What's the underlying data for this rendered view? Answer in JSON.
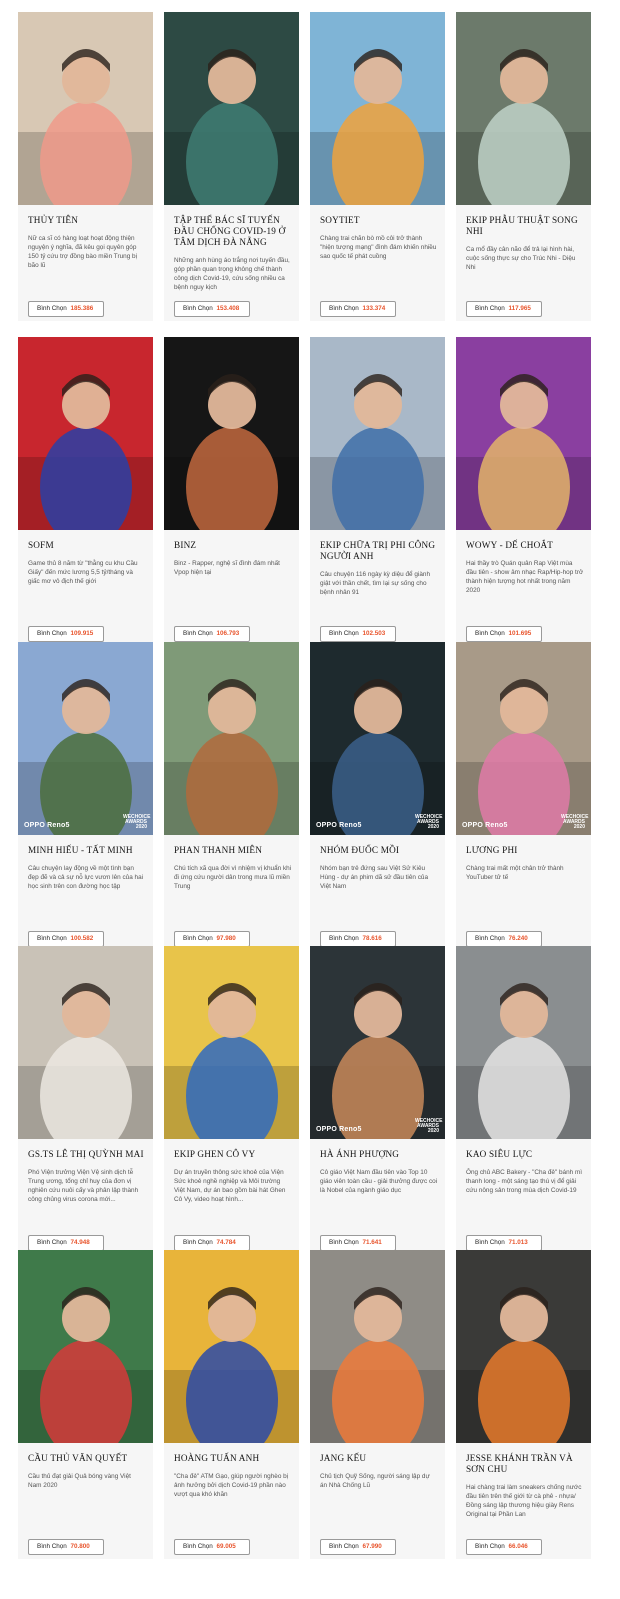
{
  "vote_label": "Bình Chọn",
  "cards": [
    {
      "name": "THỦY TIÊN",
      "desc": "Nữ ca sĩ có hàng loạt hoạt động thiện nguyện ý nghĩa, đã kêu gọi quyên góp 150 tỷ cứu trợ đồng bào miền Trung bị bão lũ",
      "votes": "185.386",
      "bg": "#d8c8b4",
      "fg": "#f09a8a"
    },
    {
      "name": "TẬP THỂ BÁC SĨ TUYẾN ĐẦU CHỐNG COVID-19 Ở TÂM DỊCH ĐÀ NẴNG",
      "desc": "Những anh hùng áo trắng nơi tuyến đầu, góp phần quan trọng không chế thành công dịch Covid-19, cứu sống nhiều ca bệnh nguy kịch",
      "votes": "153.408",
      "bg": "#2d4a44",
      "fg": "#3f7d73"
    },
    {
      "name": "SOYTIET",
      "desc": "Chàng trai chăn bò mồ côi trở thành \"hiện tượng mạng\" đình đám khiến nhiều sao quốc tế phát cuồng",
      "votes": "133.374",
      "bg": "#7fb4d6",
      "fg": "#f0a23c"
    },
    {
      "name": "EKIP PHẪU THUẬT SONG NHI",
      "desc": "Ca mổ đầy cân não để trả lại hình hài, cuộc sống thực sự cho Trúc Nhi - Diệu Nhi",
      "votes": "117.965",
      "bg": "#6c7a6b",
      "fg": "#bfd2c8"
    },
    {
      "name": "SOFM",
      "desc": "Game thủ 8 năm từ \"thằng cu khu Cầu Giấy\" đến mức lương 5,5 tỷ/tháng và giấc mơ vô địch thế giới",
      "votes": "109.915",
      "bg": "#c8262e",
      "fg": "#2a3fa6"
    },
    {
      "name": "BINZ",
      "desc": "Binz - Rapper, nghệ sĩ đình đám nhất Vpop hiện tại",
      "votes": "106.793",
      "bg": "#161616",
      "fg": "#c2683e"
    },
    {
      "name": "EKIP CHỮA TRỊ PHI CÔNG NGƯỜI ANH",
      "desc": "Câu chuyện 116 ngày kỳ diệu để giành giật với thần chết, tìm lại sự sống cho bệnh nhân 91",
      "votes": "102.503",
      "bg": "#a9b8c8",
      "fg": "#3f6fa8"
    },
    {
      "name": "WOWY - DẾ CHOẮT",
      "desc": "Hai thầy trò Quán quân Rap Việt mùa đầu tiên - show âm nhạc Rap/Hip-hop trở thành hiện tượng hot nhất trong năm 2020",
      "votes": "101.695",
      "bg": "#8a3fa0",
      "fg": "#e3b46a"
    },
    {
      "name": "MINH HIẾU - TẤT MINH",
      "desc": "Câu chuyện lay động về một tình bạn đẹp đẽ và cả sự nỗ lực vươn lên của hai học sinh trên con đường học tập",
      "votes": "100.582",
      "bg": "#8aa8d2",
      "fg": "#4b6e3c",
      "brand": "OPPO Reno5"
    },
    {
      "name": "PHAN THANH MIÊN",
      "desc": "Chú tích xã qua đời vì nhiệm vị khuẩn khi đi ứng cứu người dân trong mưa lũ miền Trung",
      "votes": "97.980",
      "bg": "#7f9a78",
      "fg": "#b26a3c"
    },
    {
      "name": "NHÓM ĐUỐC MỒI",
      "desc": "Nhóm bạn trẻ đứng sau Việt Sử Kiêu Hùng - dự án phim dã sử đầu tiên của Việt Nam",
      "votes": "78.616",
      "bg": "#1e2a2e",
      "fg": "#3b5f8a",
      "brand": "OPPO Reno5"
    },
    {
      "name": "LƯƠNG PHI",
      "desc": "Chàng trai mất một chân trở thành YouTuber tử tế",
      "votes": "76.240",
      "bg": "#a89a88",
      "fg": "#e07aa8",
      "brand": "OPPO Reno5"
    },
    {
      "name": "GS.TS LÊ THỊ QUỲNH MAI",
      "desc": "Phó Viện trưởng Viện Vệ sinh dịch tễ Trung ương, tổng chỉ huy của đơn vị nghiên cứu nuôi cấy và phân lập thành công chủng virus corona mới...",
      "votes": "74.948",
      "bg": "#c9c2b7",
      "fg": "#ece8e2"
    },
    {
      "name": "EKIP GHEN CÔ VY",
      "desc": "Dự án truyền thông sức khoẻ của Viện Sức khoẻ nghề nghiệp và Môi trường Việt Nam, dự án bao gồm bài hát Ghen Cô Vy, video hoạt hình...",
      "votes": "74.784",
      "bg": "#e8c44a",
      "fg": "#2f6ac0"
    },
    {
      "name": "HÀ ÁNH PHƯỢNG",
      "desc": "Cô giáo Việt Nam đầu tiên vào Top 10 giáo viên toàn cầu - giải thưởng được coi là Nobel của ngành giáo dục",
      "votes": "71.641",
      "bg": "#2c3438",
      "fg": "#c98a5a",
      "brand": "OPPO Reno5"
    },
    {
      "name": "KAO SIÊU LỰC",
      "desc": "Ông chủ ABC Bakery - \"Cha đẻ\" bánh mì thanh long - một sáng tạo thú vị để giải cứu nông sản trong mùa dịch Covid-19",
      "votes": "71.013",
      "bg": "#8a8e90",
      "fg": "#e4e4e4"
    },
    {
      "name": "CẦU THỦ VĂN QUYẾT",
      "desc": "Cầu thủ đạt giải Quả bóng vàng Việt Nam 2020",
      "votes": "70.800",
      "bg": "#3f7a4a",
      "fg": "#d63a3a"
    },
    {
      "name": "HOÀNG TUẤN ANH",
      "desc": "\"Cha đẻ\" ATM Gạo, giúp người nghèo bị ảnh hưởng bởi dịch Covid-19 phần nào vượt qua khó khăn",
      "votes": "69.005",
      "bg": "#e8b43a",
      "fg": "#2b4aa8"
    },
    {
      "name": "JANG KẾU",
      "desc": "Chủ tịch Quỹ Sống, người sáng lập dự án Nhà Chống Lũ",
      "votes": "67.990",
      "bg": "#8f8c86",
      "fg": "#ef7a3a"
    },
    {
      "name": "JESSE KHÁNH TRẦN VÀ SƠN CHU",
      "desc": "Hai chàng trai làm sneakers chống nước đầu tiên trên thế giới từ cà phê - nhựa/ Đồng sáng lập thương hiệu giày Rens Original tại Phần Lan",
      "votes": "66.046",
      "bg": "#3a3a38",
      "fg": "#e87a2c"
    }
  ]
}
